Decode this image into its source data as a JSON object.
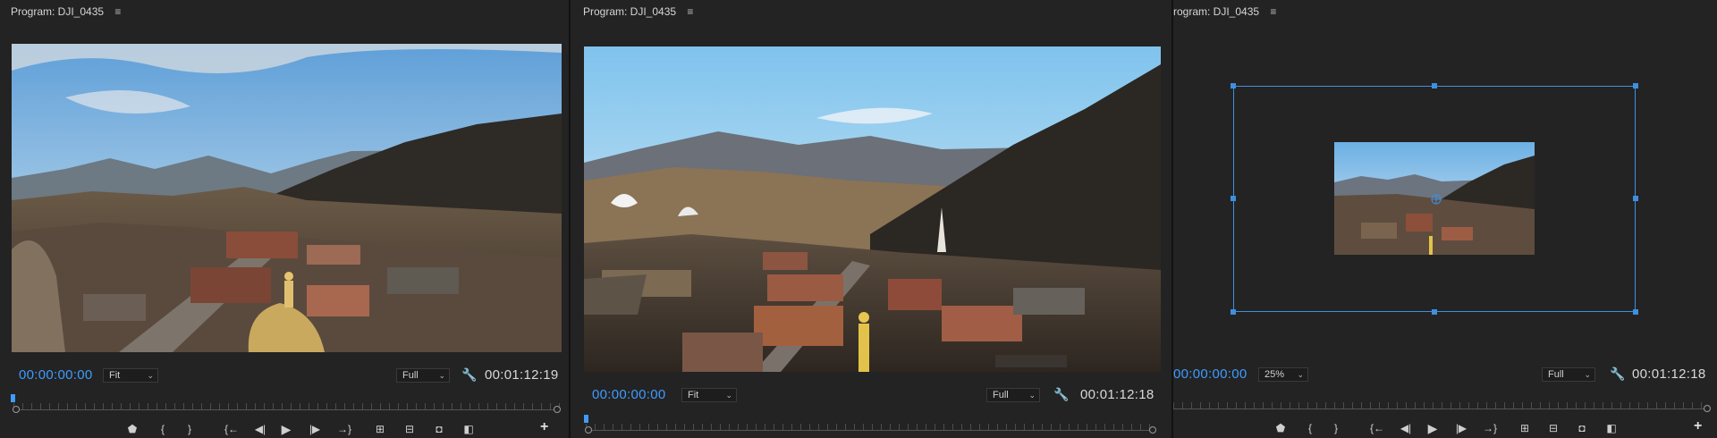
{
  "panels": [
    {
      "title": "Program: DJI_0435",
      "menu_icon": "≡",
      "current_timecode": "00:00:00:00",
      "zoom_value": "Fit",
      "resolution_value": "Full",
      "duration_timecode": "00:01:12:19"
    },
    {
      "title": "Program: DJI_0435",
      "menu_icon": "≡",
      "current_timecode": "00:00:00:00",
      "zoom_value": "Fit",
      "resolution_value": "Full",
      "duration_timecode": "00:01:12:18"
    },
    {
      "title": "rogram: DJI_0435",
      "menu_icon": "≡",
      "current_timecode": "00:00:00:00",
      "zoom_value": "25%",
      "resolution_value": "Full",
      "duration_timecode": "00:01:12:18"
    }
  ],
  "icons": {
    "marker": "⬟",
    "mark_in": "{",
    "mark_out": "}",
    "go_to_in": "{←",
    "step_back": "◀|",
    "play": "▶",
    "step_forward": "|▶",
    "go_to_out": "→}",
    "lift": "⊞",
    "extract": "⊟",
    "export_frame": "◘",
    "compare": "◧",
    "add": "+",
    "wrench": "🔧",
    "chevron": "⌄"
  },
  "colors": {
    "panel_bg": "#232323",
    "accent_blue": "#3f9bff",
    "selection_blue": "#3f8fe0"
  }
}
